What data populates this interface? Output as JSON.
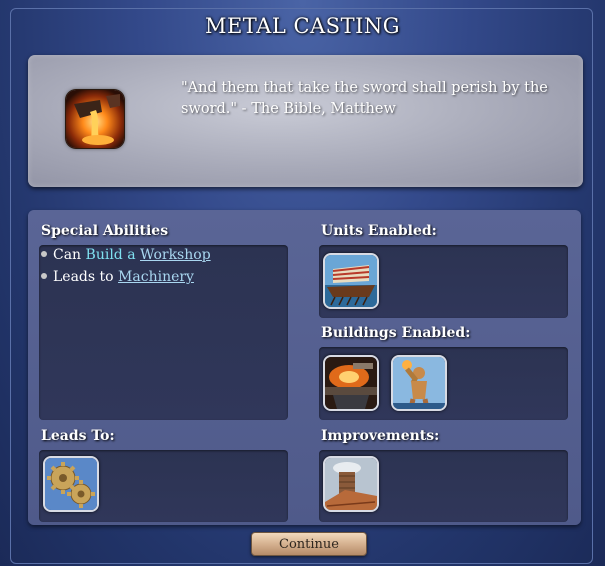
{
  "title": "METAL CASTING",
  "quote": {
    "icon": "metal-casting-icon",
    "text": "\"And them that take the sword shall perish by the sword.\" - The Bible, Matthew"
  },
  "special_abilities": {
    "header": "Special Abilities",
    "items": [
      {
        "prefix": "Can",
        "action": "Build a",
        "link": "Workshop"
      },
      {
        "prefix": "Leads to",
        "link": "Machinery"
      }
    ]
  },
  "units_enabled": {
    "header": "Units Enabled:",
    "items": [
      {
        "icon": "galley-unit-icon"
      }
    ]
  },
  "buildings_enabled": {
    "header": "Buildings Enabled:",
    "items": [
      {
        "icon": "forge-building-icon"
      },
      {
        "icon": "colossus-wonder-icon"
      }
    ]
  },
  "leads_to": {
    "header": "Leads To:",
    "items": [
      {
        "icon": "machinery-gears-icon"
      }
    ]
  },
  "improvements": {
    "header": "Improvements:",
    "items": [
      {
        "icon": "workshop-improvement-icon"
      }
    ]
  },
  "continue_label": "Continue",
  "colors": {
    "panel_blue": "#4f5a8a",
    "link_cyan": "#7fe0f0",
    "link_blue": "#a9d7f0"
  }
}
